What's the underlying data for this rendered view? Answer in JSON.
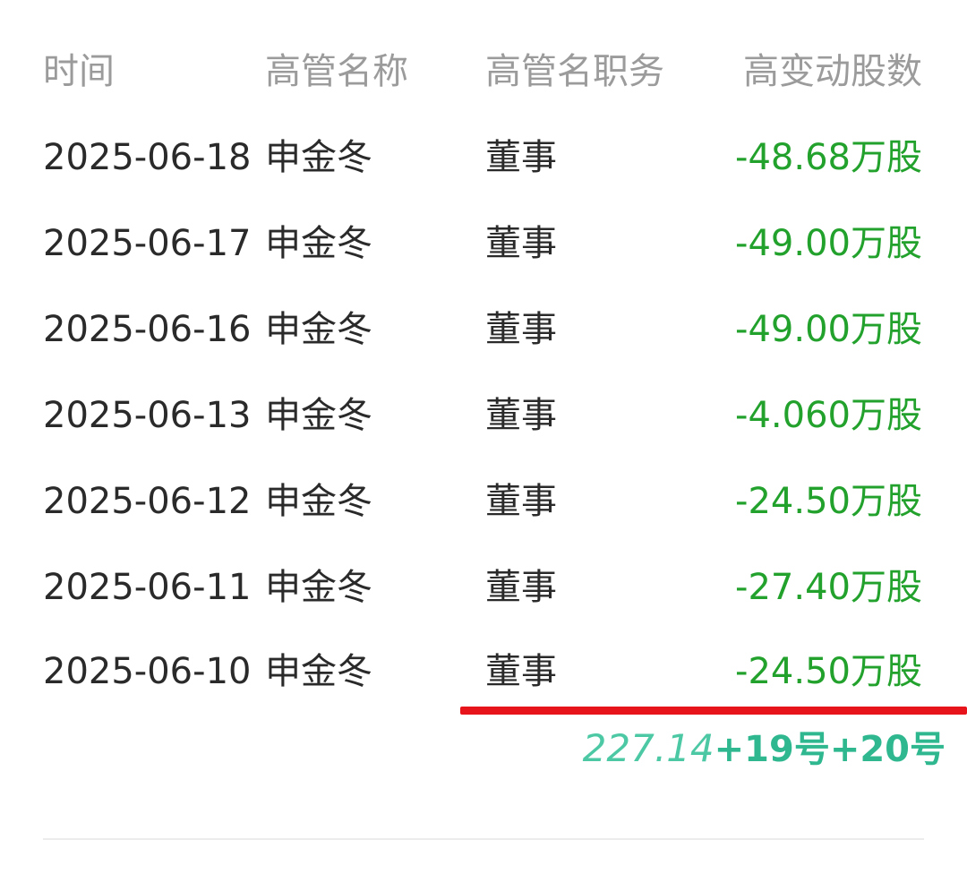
{
  "table": {
    "headers": {
      "date": "时间",
      "name": "高管名称",
      "title": "高管名职务",
      "change": "高变动股数"
    },
    "rows": [
      {
        "date": "2025-06-18",
        "name": "申金冬",
        "title": "董事",
        "change": "-48.68万股"
      },
      {
        "date": "2025-06-17",
        "name": "申金冬",
        "title": "董事",
        "change": "-49.00万股"
      },
      {
        "date": "2025-06-16",
        "name": "申金冬",
        "title": "董事",
        "change": "-49.00万股"
      },
      {
        "date": "2025-06-13",
        "name": "申金冬",
        "title": "董事",
        "change": "-4.060万股"
      },
      {
        "date": "2025-06-12",
        "name": "申金冬",
        "title": "董事",
        "change": "-24.50万股"
      },
      {
        "date": "2025-06-11",
        "name": "申金冬",
        "title": "董事",
        "change": "-27.40万股"
      },
      {
        "date": "2025-06-10",
        "name": "申金冬",
        "title": "董事",
        "change": "-24.50万股"
      }
    ]
  },
  "annotation": {
    "total": "227.14",
    "suffix": "+19号+20号"
  },
  "colors": {
    "header_text": "#9b9b9b",
    "body_text": "#2a2a2a",
    "change_negative": "#22a12c",
    "red_marker": "#e8141c",
    "annotation_total": "#4cc9a4",
    "annotation_suffix": "#2fb88f",
    "divider": "#ececec"
  }
}
